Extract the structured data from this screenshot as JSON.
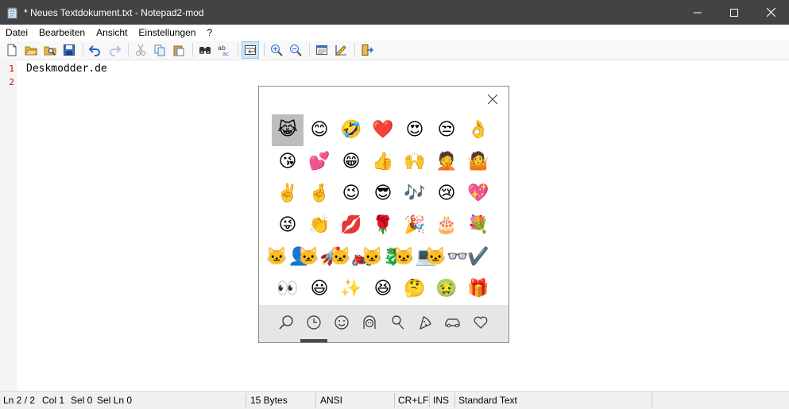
{
  "window": {
    "title": "* Neues Textdokument.txt - Notepad2-mod",
    "controls": [
      "minimize-icon",
      "maximize-icon",
      "close-icon"
    ]
  },
  "menu": {
    "items": [
      "Datei",
      "Bearbeiten",
      "Ansicht",
      "Einstellungen",
      "?"
    ]
  },
  "toolbar": {
    "buttons": [
      "new-file-icon",
      "open-folder-icon",
      "browse-icon",
      "save-icon",
      "undo-icon",
      "redo-icon",
      "cut-icon",
      "copy-icon",
      "paste-icon",
      "find-icon",
      "replace-icon",
      "word-wrap-icon",
      "zoom-in-icon",
      "zoom-out-icon",
      "scheme-icon",
      "customize-scheme-icon",
      "exit-icon"
    ],
    "active": "word-wrap-icon"
  },
  "editor": {
    "line_numbers": [
      "1",
      "2"
    ],
    "lines": [
      "Deskmodder.de",
      ""
    ]
  },
  "emoji_panel": {
    "selected_index": 0,
    "emojis": [
      "😹",
      "😊",
      "🤣",
      "❤️",
      "😍",
      "😒",
      "👌",
      "😘",
      "💕",
      "😁",
      "👍",
      "🙌",
      "🤦",
      "🤷",
      "✌️",
      "🤞",
      "😉",
      "😎",
      "🎶",
      "😢",
      "💖",
      "😜",
      "👏",
      "💋",
      "🌹",
      "🎉",
      "🎂",
      "💐",
      "🐱‍👤",
      "🐱‍🚀",
      "🐱‍🏍",
      "🐱‍🐉",
      "🐱‍💻",
      "🐱‍👓",
      "✔️",
      "👀",
      "😃",
      "✨",
      "😆",
      "🤔",
      "🤢",
      "🎁"
    ],
    "tabs": [
      "search-icon",
      "recent-icon",
      "smiley-icon",
      "people-icon",
      "celebration-icon",
      "food-icon",
      "transport-icon",
      "heart-icon"
    ],
    "active_tab": "recent-icon"
  },
  "status": {
    "ln": "Ln 2 / 2",
    "col": "Col 1",
    "sel": "Sel 0",
    "sel_ln": "Sel Ln 0",
    "size": "15 Bytes",
    "encoding": "ANSI",
    "eol": "CR+LF",
    "ins": "INS",
    "scheme": "Standard Text"
  }
}
